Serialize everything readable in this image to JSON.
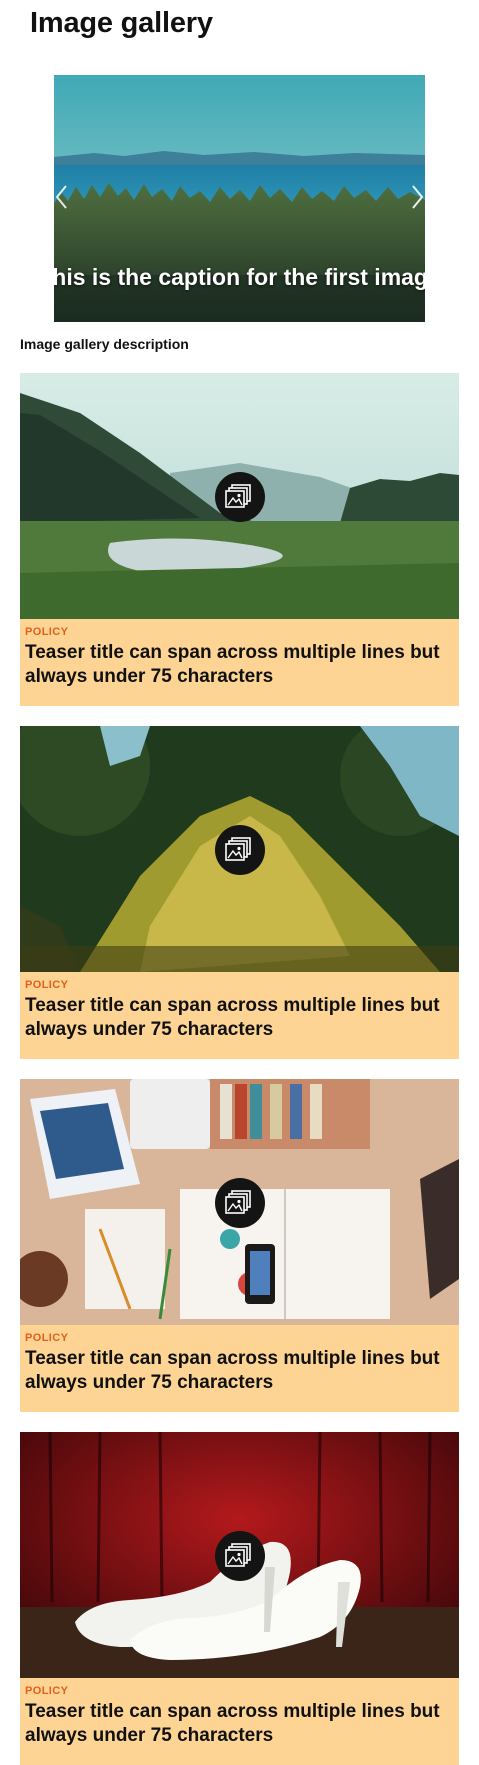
{
  "page": {
    "title": "Image gallery",
    "description": "Image gallery description"
  },
  "slider": {
    "caption": "This is the caption for the first image",
    "prev_icon": "chevron-left-icon",
    "next_icon": "chevron-right-icon"
  },
  "teasers": [
    {
      "tag": "POLICY",
      "title": "Teaser title can span across multiple lines but always under 75 characters",
      "image": "river-valley-photo",
      "badge_icon": "gallery-icon"
    },
    {
      "tag": "POLICY",
      "title": "Teaser title can span across multiple lines but always under 75 characters",
      "image": "moss-tree-photo",
      "badge_icon": "gallery-icon"
    },
    {
      "tag": "POLICY",
      "title": "Teaser title can span across multiple lines but always under 75 characters",
      "image": "desk-flatlay-photo",
      "badge_icon": "gallery-icon"
    },
    {
      "tag": "POLICY",
      "title": "Teaser title can span across multiple lines but always under 75 characters",
      "image": "white-heels-photo",
      "badge_icon": "gallery-icon"
    }
  ],
  "colors": {
    "teaser_background": "#fdd493",
    "tag": "#e2601b",
    "badge": "#141414"
  }
}
